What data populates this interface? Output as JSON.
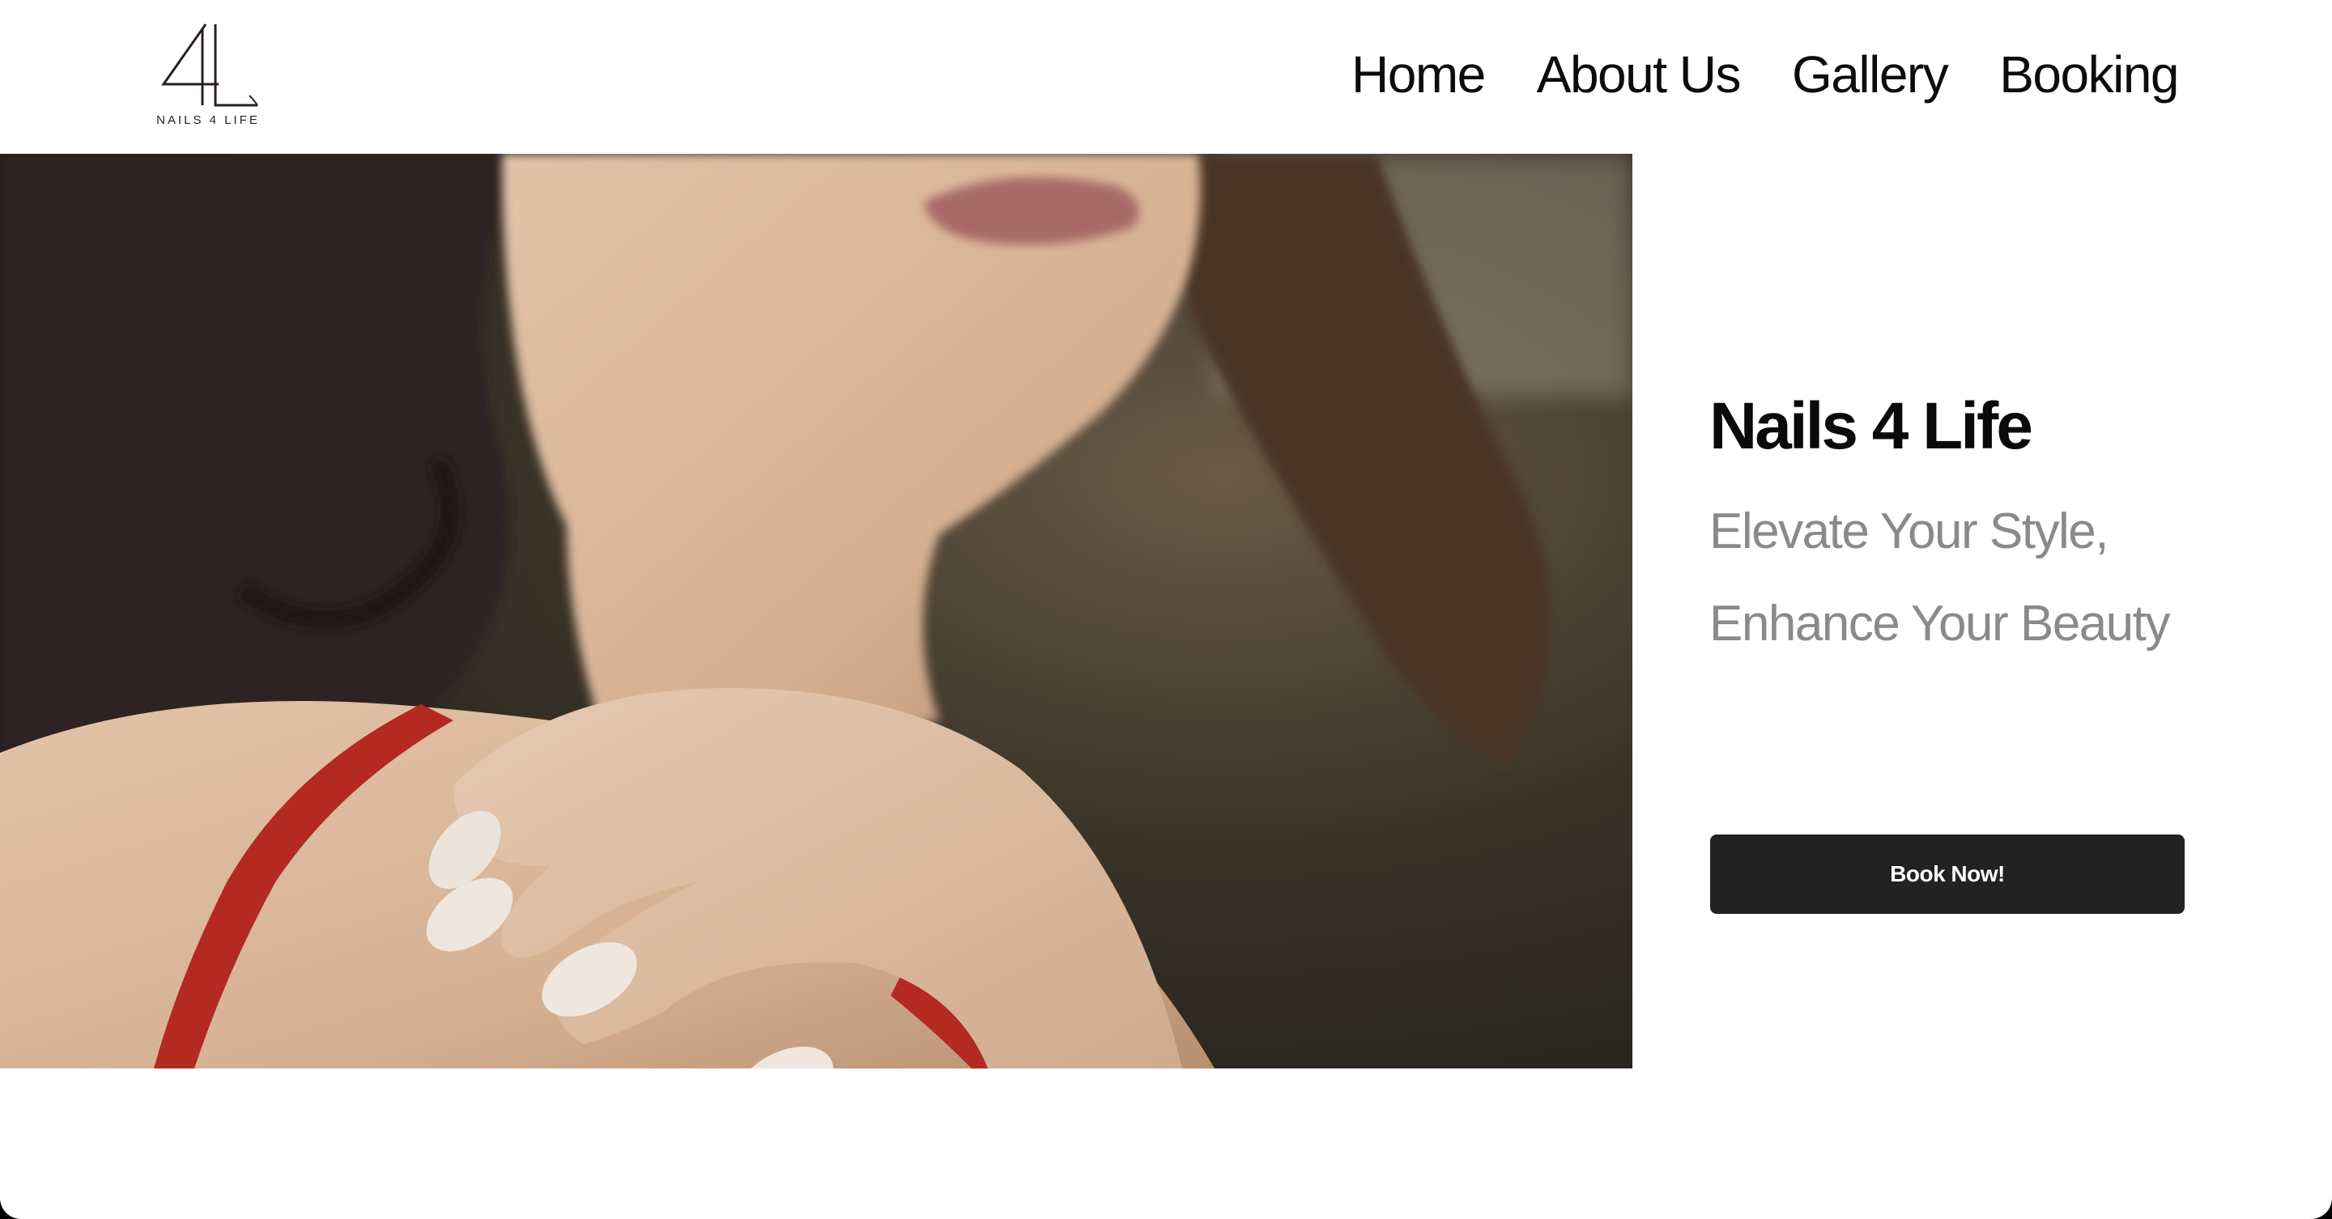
{
  "header": {
    "logo": {
      "mark": "4L",
      "text": "NAILS 4 LIFE"
    },
    "nav": [
      {
        "label": "Home"
      },
      {
        "label": "About Us"
      },
      {
        "label": "Gallery"
      },
      {
        "label": "Booking"
      }
    ]
  },
  "hero": {
    "image": "woman-hand-on-shoulder-with-white-almond-nails-photo",
    "title": "Nails 4 Life",
    "tagline_line1": "Elevate Your Style,",
    "tagline_line2": "Enhance Your Beauty",
    "cta_label": "Book Now!"
  },
  "colors": {
    "background": "#ffffff",
    "text_primary": "#0a0a0a",
    "text_muted": "#8a8a8a",
    "button_bg": "#222222",
    "button_text": "#ffffff"
  }
}
